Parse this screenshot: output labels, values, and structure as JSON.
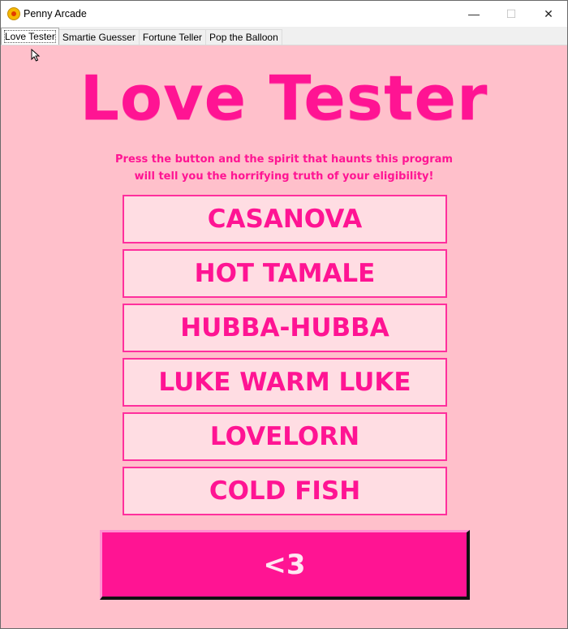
{
  "window": {
    "title": "Penny Arcade"
  },
  "window_controls": {
    "minimize": "—",
    "maximize": "☐",
    "close": "✕"
  },
  "tabs": [
    {
      "label": "Love Tester",
      "active": true
    },
    {
      "label": "Smartie Guesser",
      "active": false
    },
    {
      "label": "Fortune Teller",
      "active": false
    },
    {
      "label": "Pop the Balloon",
      "active": false
    }
  ],
  "main": {
    "heading": "Love Tester",
    "subtitle_line1": "Press the button and the spirit that haunts this program",
    "subtitle_line2": "will tell you the horrifying truth of your eligibility!",
    "choices": [
      {
        "label": "CASANOVA"
      },
      {
        "label": "HOT TAMALE"
      },
      {
        "label": "HUBBA-HUBBA"
      },
      {
        "label": "LUKE WARM LUKE"
      },
      {
        "label": "LOVELORN"
      },
      {
        "label": "COLD FISH"
      }
    ],
    "button_label": "<3"
  },
  "colors": {
    "background": "#ffc0cb",
    "accent": "#ff1493",
    "choice_fill": "#ffdde3",
    "choice_border": "#ff2f9d"
  }
}
